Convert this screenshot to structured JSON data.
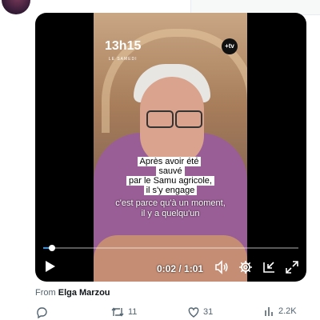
{
  "video": {
    "logo_text": "13h15",
    "logo_subtext": "LE SAMEDI",
    "channel_badge": "+tv",
    "caption_lines": [
      "Après avoir été sauvé",
      "par le Samu agricole,",
      "il s'y engage"
    ],
    "subtitle_lines": [
      "c'est parce qu'à un moment,",
      "il y a quelqu'un"
    ],
    "time_display": "0:02 / 1:01",
    "progress_fraction": 0.033
  },
  "attribution": {
    "prefix": "From",
    "author": "Elga Marzou"
  },
  "actions": {
    "reply_icon": "reply-icon",
    "retweet_count": "11",
    "like_count": "31",
    "views_count": "2.2K"
  },
  "colors": {
    "accent": "#1d9bf0",
    "muted": "#536471",
    "text": "#0f1419"
  }
}
